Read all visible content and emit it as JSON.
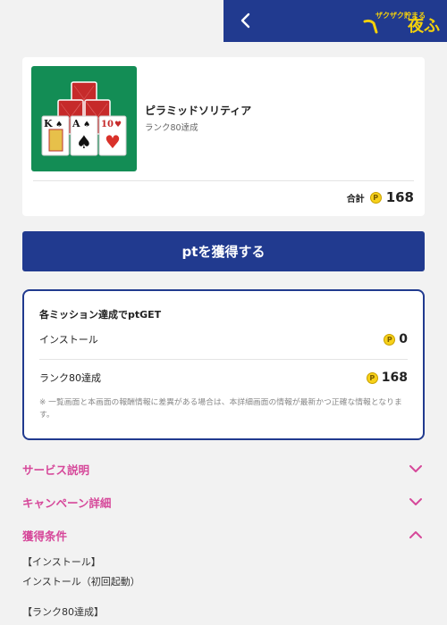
{
  "header": {
    "back_icon": "chevron-left-icon",
    "logo_small_text": "ザクザク貯まる",
    "logo_big_text": "夜ふ"
  },
  "app": {
    "name": "ピラミッドソリティア",
    "subtitle": "ランク80達成",
    "thumbnail_cards": [
      "K",
      "A",
      "10"
    ],
    "total_label": "合計",
    "total_value": "168"
  },
  "cta_label": "ptを獲得する",
  "missions": {
    "title": "各ミッション達成でptGET",
    "items": [
      {
        "label": "インストール",
        "value": "0"
      },
      {
        "label": "ランク80達成",
        "value": "168"
      }
    ],
    "note": "※ 一覧画面と本画面の報酬情報に差異がある場合は、本詳細画面の情報が最新かつ正確な情報となります。"
  },
  "accordions": [
    {
      "title": "サービス説明",
      "state": "collapsed"
    },
    {
      "title": "キャンペーン詳細",
      "state": "collapsed"
    },
    {
      "title": "獲得条件",
      "state": "expanded"
    }
  ],
  "conditions": [
    "【インストール】",
    "インストール（初回起動）",
    "【ランク80達成】"
  ],
  "coin_symbol": "P",
  "colors": {
    "brand_navy": "#213a8f",
    "accent_pink": "#d6489a",
    "coin_yellow": "#f7d11a",
    "felt_green": "#138d55",
    "logo_yellow": "#f5d10a"
  }
}
